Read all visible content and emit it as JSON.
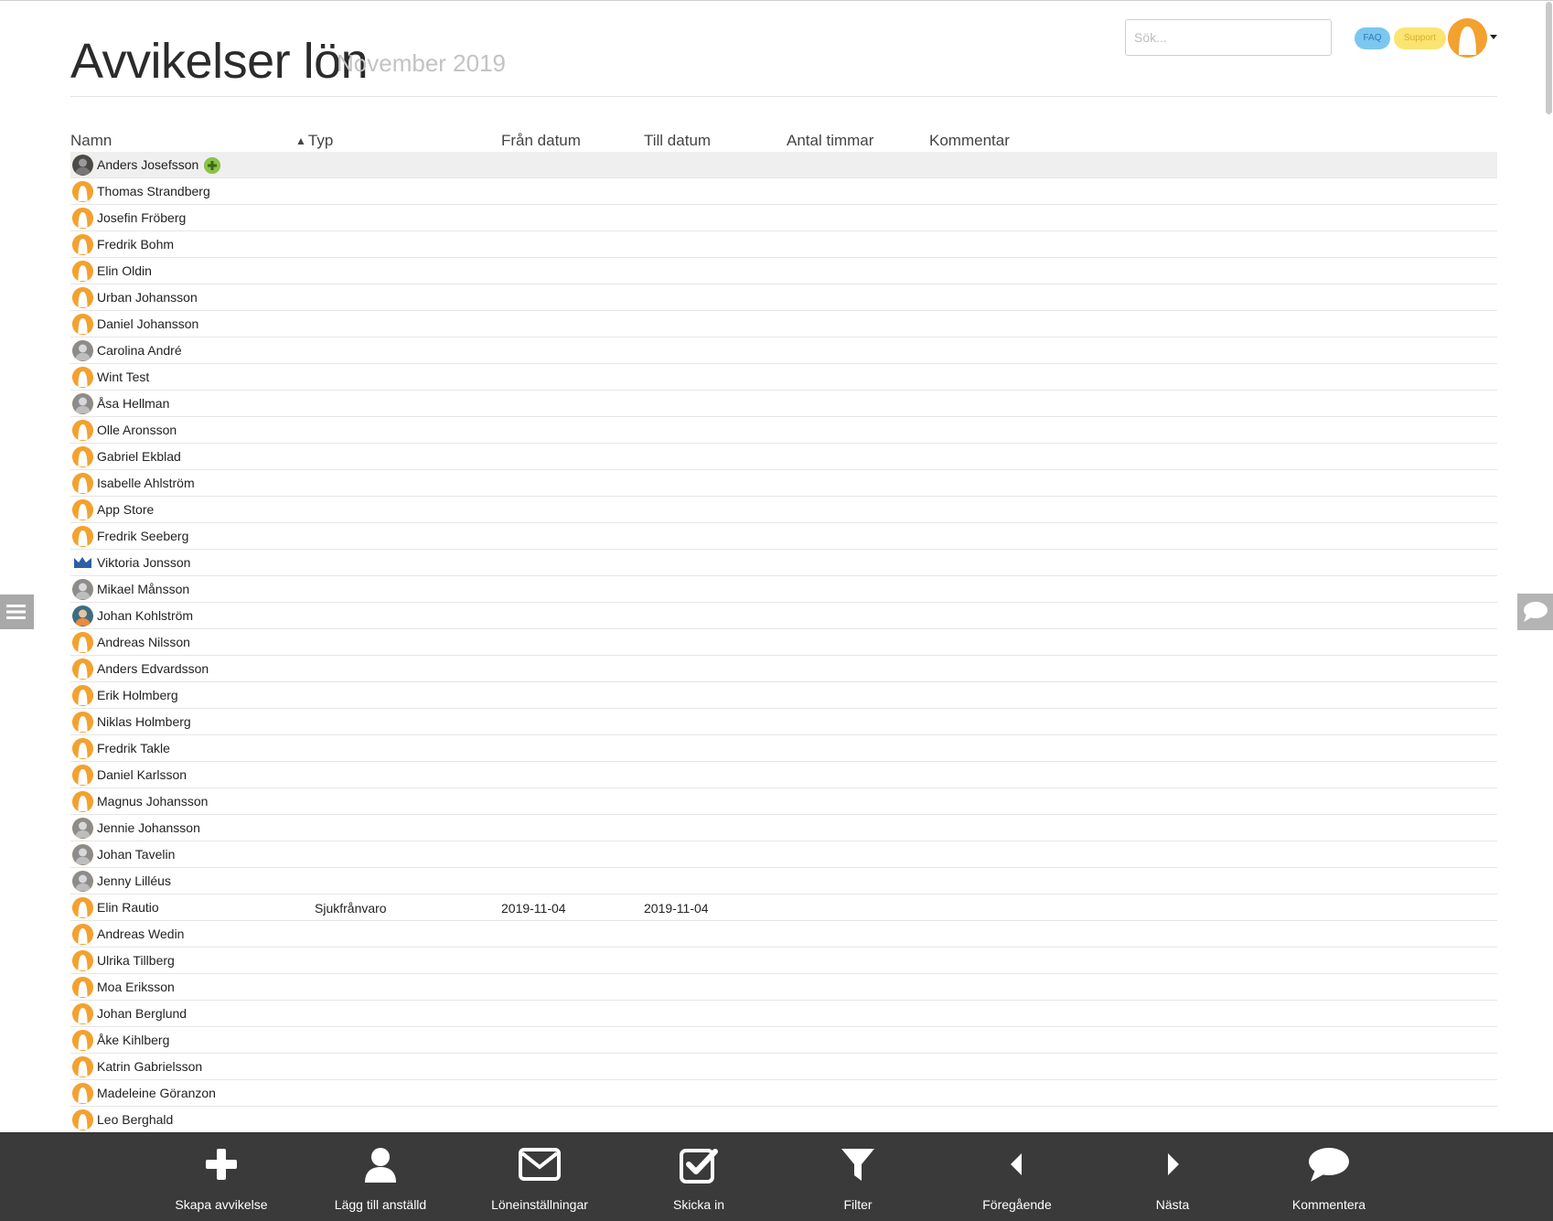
{
  "header": {
    "title": "Avvikelser lön",
    "subtitle": "November 2019",
    "search_placeholder": "Sök...",
    "faq_label": "FAQ",
    "support_label": "Support"
  },
  "table": {
    "columns": {
      "name": "Namn",
      "type": "Typ",
      "from": "Från datum",
      "to": "Till datum",
      "hours": "Antal timmar",
      "comment": "Kommentar"
    },
    "sort_indicator": "▲",
    "rows": [
      {
        "name": "Anders Josefsson",
        "avatar": "photo-dark-icon",
        "type": "",
        "from": "",
        "to": "",
        "hours": "",
        "comment": "",
        "highlight": true
      },
      {
        "name": "Thomas Strandberg",
        "avatar": "default-avatar-icon",
        "type": "",
        "from": "",
        "to": "",
        "hours": "",
        "comment": ""
      },
      {
        "name": "Josefin Fröberg",
        "avatar": "default-avatar-icon",
        "type": "",
        "from": "",
        "to": "",
        "hours": "",
        "comment": ""
      },
      {
        "name": "Fredrik Bohm",
        "avatar": "default-avatar-icon",
        "type": "",
        "from": "",
        "to": "",
        "hours": "",
        "comment": ""
      },
      {
        "name": "Elin Oldin",
        "avatar": "default-avatar-icon",
        "type": "",
        "from": "",
        "to": "",
        "hours": "",
        "comment": ""
      },
      {
        "name": "Urban Johansson",
        "avatar": "default-avatar-icon",
        "type": "",
        "from": "",
        "to": "",
        "hours": "",
        "comment": ""
      },
      {
        "name": "Daniel Johansson",
        "avatar": "default-avatar-icon",
        "type": "",
        "from": "",
        "to": "",
        "hours": "",
        "comment": ""
      },
      {
        "name": "Carolina André",
        "avatar": "photo-icon",
        "type": "",
        "from": "",
        "to": "",
        "hours": "",
        "comment": ""
      },
      {
        "name": "Wint Test",
        "avatar": "default-avatar-icon",
        "type": "",
        "from": "",
        "to": "",
        "hours": "",
        "comment": ""
      },
      {
        "name": "Åsa Hellman",
        "avatar": "photo-icon",
        "type": "",
        "from": "",
        "to": "",
        "hours": "",
        "comment": ""
      },
      {
        "name": "Olle Aronsson",
        "avatar": "default-avatar-icon",
        "type": "",
        "from": "",
        "to": "",
        "hours": "",
        "comment": ""
      },
      {
        "name": "Gabriel Ekblad",
        "avatar": "default-avatar-icon",
        "type": "",
        "from": "",
        "to": "",
        "hours": "",
        "comment": ""
      },
      {
        "name": "Isabelle Ahlström",
        "avatar": "default-avatar-icon",
        "type": "",
        "from": "",
        "to": "",
        "hours": "",
        "comment": ""
      },
      {
        "name": "App Store",
        "avatar": "default-avatar-icon",
        "type": "",
        "from": "",
        "to": "",
        "hours": "",
        "comment": ""
      },
      {
        "name": "Fredrik Seeberg",
        "avatar": "default-avatar-icon",
        "type": "",
        "from": "",
        "to": "",
        "hours": "",
        "comment": ""
      },
      {
        "name": "Viktoria Jonsson",
        "avatar": "logo-icon",
        "type": "",
        "from": "",
        "to": "",
        "hours": "",
        "comment": ""
      },
      {
        "name": "Mikael Månsson",
        "avatar": "photo-icon",
        "type": "",
        "from": "",
        "to": "",
        "hours": "",
        "comment": ""
      },
      {
        "name": "Johan Kohlström",
        "avatar": "photo-color-icon",
        "type": "",
        "from": "",
        "to": "",
        "hours": "",
        "comment": ""
      },
      {
        "name": "Andreas Nilsson",
        "avatar": "default-avatar-icon",
        "type": "",
        "from": "",
        "to": "",
        "hours": "",
        "comment": ""
      },
      {
        "name": "Anders Edvardsson",
        "avatar": "default-avatar-icon",
        "type": "",
        "from": "",
        "to": "",
        "hours": "",
        "comment": ""
      },
      {
        "name": "Erik Holmberg",
        "avatar": "default-avatar-icon",
        "type": "",
        "from": "",
        "to": "",
        "hours": "",
        "comment": ""
      },
      {
        "name": "Niklas Holmberg",
        "avatar": "default-avatar-icon",
        "type": "",
        "from": "",
        "to": "",
        "hours": "",
        "comment": ""
      },
      {
        "name": "Fredrik Takle",
        "avatar": "default-avatar-icon",
        "type": "",
        "from": "",
        "to": "",
        "hours": "",
        "comment": ""
      },
      {
        "name": "Daniel Karlsson",
        "avatar": "default-avatar-icon",
        "type": "",
        "from": "",
        "to": "",
        "hours": "",
        "comment": ""
      },
      {
        "name": "Magnus Johansson",
        "avatar": "default-avatar-icon",
        "type": "",
        "from": "",
        "to": "",
        "hours": "",
        "comment": ""
      },
      {
        "name": "Jennie Johansson",
        "avatar": "photo-icon",
        "type": "",
        "from": "",
        "to": "",
        "hours": "",
        "comment": ""
      },
      {
        "name": "Johan Tavelin",
        "avatar": "photo-icon",
        "type": "",
        "from": "",
        "to": "",
        "hours": "",
        "comment": ""
      },
      {
        "name": "Jenny Lilléus",
        "avatar": "photo-icon",
        "type": "",
        "from": "",
        "to": "",
        "hours": "",
        "comment": ""
      },
      {
        "name": "Elin Rautio",
        "avatar": "default-avatar-icon",
        "type": "Sjukfrånvaro",
        "from": "2019-11-04",
        "to": "2019-11-04",
        "hours": "",
        "comment": ""
      },
      {
        "name": "Andreas Wedin",
        "avatar": "default-avatar-icon",
        "type": "",
        "from": "",
        "to": "",
        "hours": "",
        "comment": ""
      },
      {
        "name": "Ulrika Tillberg",
        "avatar": "default-avatar-icon",
        "type": "",
        "from": "",
        "to": "",
        "hours": "",
        "comment": ""
      },
      {
        "name": "Moa Eriksson",
        "avatar": "default-avatar-icon",
        "type": "",
        "from": "",
        "to": "",
        "hours": "",
        "comment": ""
      },
      {
        "name": "Johan Berglund",
        "avatar": "default-avatar-icon",
        "type": "",
        "from": "",
        "to": "",
        "hours": "",
        "comment": ""
      },
      {
        "name": "Åke Kihlberg",
        "avatar": "default-avatar-icon",
        "type": "",
        "from": "",
        "to": "",
        "hours": "",
        "comment": ""
      },
      {
        "name": "Katrin Gabrielsson",
        "avatar": "default-avatar-icon",
        "type": "",
        "from": "",
        "to": "",
        "hours": "",
        "comment": ""
      },
      {
        "name": "Madeleine Göranzon",
        "avatar": "default-avatar-icon",
        "type": "",
        "from": "",
        "to": "",
        "hours": "",
        "comment": ""
      },
      {
        "name": "Leo Berghald",
        "avatar": "default-avatar-icon",
        "type": "",
        "from": "",
        "to": "",
        "hours": "",
        "comment": ""
      }
    ]
  },
  "toolbar": {
    "buttons": [
      {
        "label": "Skapa avvikelse",
        "icon": "plus-icon"
      },
      {
        "label": "Lägg till anställd",
        "icon": "user-icon"
      },
      {
        "label": "Löneinställningar",
        "icon": "envelope-icon"
      },
      {
        "label": "Skicka in",
        "icon": "check-square-icon"
      },
      {
        "label": "Filter",
        "icon": "filter-icon"
      },
      {
        "label": "Föregående",
        "icon": "caret-left-icon"
      },
      {
        "label": "Nästa",
        "icon": "caret-right-icon"
      },
      {
        "label": "Kommentera",
        "icon": "comment-icon"
      }
    ]
  },
  "colors": {
    "accent_orange": "#f3a12f",
    "add_green": "#8bc34a",
    "faq_blue": "#7cc7ef",
    "support_yellow": "#fbe471",
    "toolbar_bg": "#3a3a3a"
  }
}
